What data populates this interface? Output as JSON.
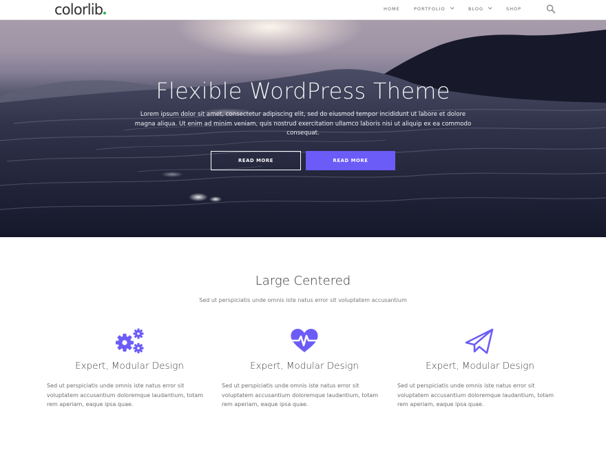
{
  "brand": {
    "logo_text": "colorlib",
    "dot_color": "#2fb34b"
  },
  "nav": {
    "items": [
      {
        "label": "HOME",
        "has_dropdown": false
      },
      {
        "label": "PORTFOLIO",
        "has_dropdown": true
      },
      {
        "label": "BLOG",
        "has_dropdown": true
      },
      {
        "label": "SHOP",
        "has_dropdown": false
      }
    ],
    "search_icon": "search-icon"
  },
  "hero": {
    "title": "Flexible WordPress Theme",
    "text": "Lorem ipsum dolor sit amet, consectetur adipiscing elit, sed do eiusmod tempor incididunt ut labore et dolore magna aliqua. Ut enim ad minim veniam, quis nostrud exercitation ullamco laboris nisi ut aliquip ex ea commodo consequat.",
    "buttons": [
      {
        "label": "READ MORE",
        "style": "outline"
      },
      {
        "label": "READ MORE",
        "style": "solid"
      }
    ]
  },
  "section": {
    "title": "Large Centered",
    "subtitle": "Sed ut perspiciatis unde omnis iste natus error sit voluptatem accusantium",
    "features": [
      {
        "icon": "gears-icon",
        "title": "Expert, Modular Design",
        "text": "Sed ut perspiciatis unde omnis iste natus error sit voluptatem accusantium doloremque laudantium, totam rem aperiam, eaque ipsa quae."
      },
      {
        "icon": "heartbeat-icon",
        "title": "Expert, Modular Design",
        "text": "Sed ut perspiciatis unde omnis iste natus error sit voluptatem accusantium doloremque laudantium, totam rem aperiam, eaque ipsa quae."
      },
      {
        "icon": "paper-plane-icon",
        "title": "Expert, Modular Design",
        "text": "Sed ut perspiciatis unde omnis iste natus error sit voluptatem accusantium doloremque laudantium, totam rem aperiam, eaque ipsa quae."
      }
    ]
  },
  "colors": {
    "accent": "#6c5cf7",
    "text": "#333333",
    "muted": "#777777"
  }
}
